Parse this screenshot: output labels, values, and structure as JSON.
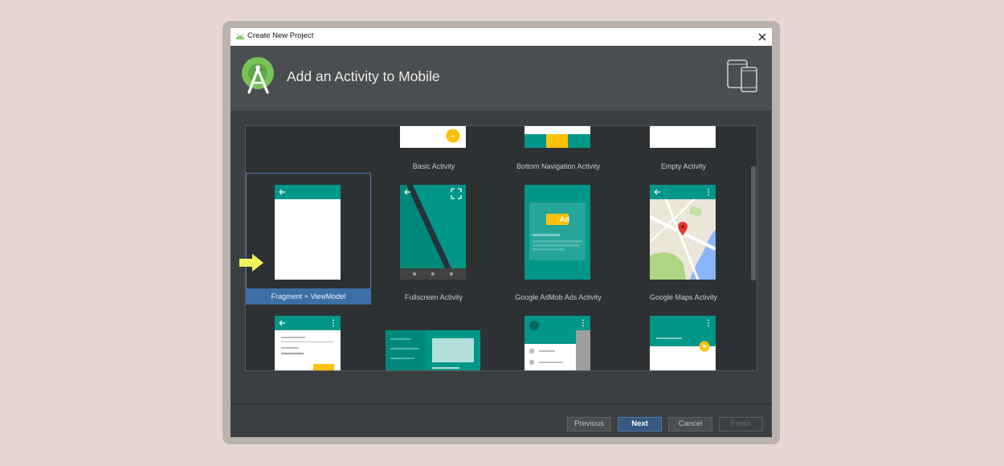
{
  "window": {
    "title": "Create New Project"
  },
  "header": {
    "title": "Add an Activity to Mobile"
  },
  "gallery": {
    "templates": [
      {
        "label": "Basic Activity"
      },
      {
        "label": "Bottom Navigation Activity"
      },
      {
        "label": "Empty Activity"
      },
      {
        "label": "Fragment + ViewModel",
        "selected": true
      },
      {
        "label": "Fullscreen Activity"
      },
      {
        "label": "Google AdMob Ads Activity"
      },
      {
        "label": "Google Maps Activity"
      }
    ],
    "admob_badge": "Ad"
  },
  "footer": {
    "previous": "Previous",
    "next": "Next",
    "cancel": "Cancel",
    "finish": "Finish"
  },
  "colors": {
    "teal": "#009688",
    "dark_teal": "#00796b",
    "accent": "#ffc107",
    "selection": "#3d6ea5"
  }
}
